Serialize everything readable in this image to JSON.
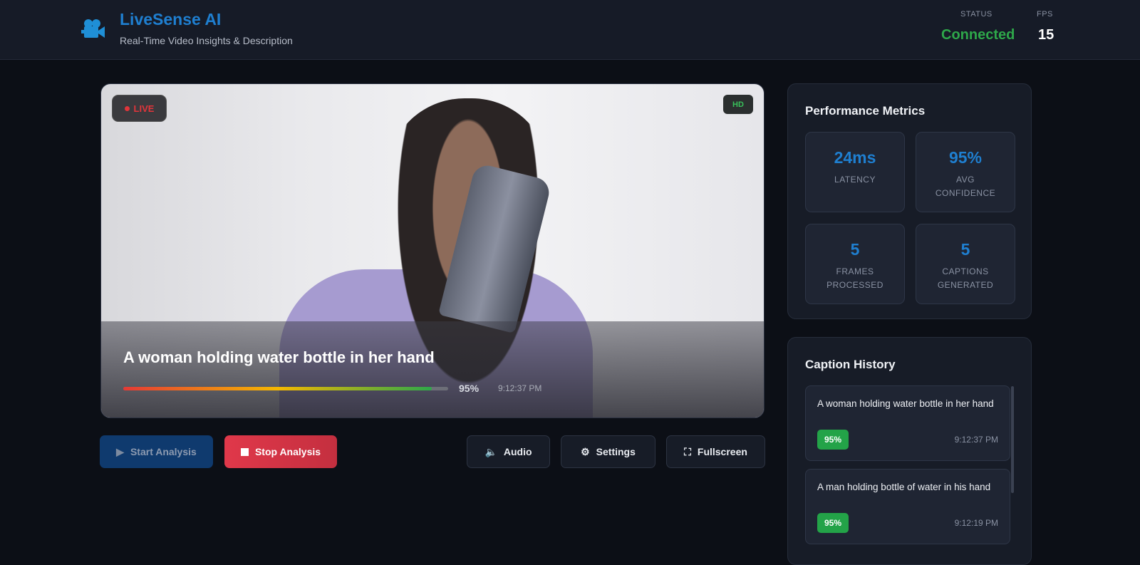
{
  "header": {
    "title": "LiveSense AI",
    "subtitle": "Real-Time Video Insights & Description",
    "logo_icon": "video-camera-icon",
    "status_label": "STATUS",
    "status_value": "Connected",
    "fps_label": "FPS",
    "fps_value": "15",
    "status_color": "#2ea84a"
  },
  "video": {
    "live_label": "LIVE",
    "hd_label": "HD",
    "caption": "A woman holding water bottle in her hand",
    "confidence": "95%",
    "confidence_fraction": 0.95,
    "time": "9:12:37 PM"
  },
  "controls": {
    "start": "Start Analysis",
    "stop": "Stop Analysis",
    "audio": "Audio",
    "settings": "Settings",
    "fullscreen": "Fullscreen"
  },
  "metrics": {
    "title": "Performance Metrics",
    "items": [
      {
        "value": "24ms",
        "label": "LATENCY"
      },
      {
        "value": "95%",
        "label": "AVG CONFIDENCE"
      },
      {
        "value": "5",
        "label": "FRAMES PROCESSED"
      },
      {
        "value": "5",
        "label": "CAPTIONS GENERATED"
      }
    ]
  },
  "history": {
    "title": "Caption History",
    "items": [
      {
        "text": "A woman holding water bottle in her hand",
        "confidence": "95%",
        "time": "9:12:37 PM"
      },
      {
        "text": "A man holding bottle of water in his hand",
        "confidence": "95%",
        "time": "9:12:19 PM"
      }
    ]
  }
}
